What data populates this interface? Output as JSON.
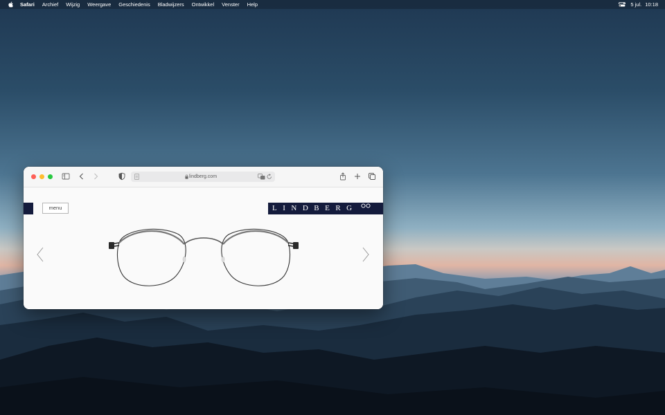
{
  "menubar": {
    "app_name": "Safari",
    "items": [
      "Archief",
      "Wijzig",
      "Weergave",
      "Geschiedenis",
      "Bladwijzers",
      "Ontwikkel",
      "Venster",
      "Help"
    ],
    "date": "5 jul.",
    "time": "10:18"
  },
  "browser": {
    "url": "lindberg.com",
    "icons": [
      "sidebar-icon",
      "back-icon",
      "forward-icon",
      "privacy-shield-icon",
      "page-icon",
      "lock-icon",
      "translate-icon",
      "reload-icon",
      "share-icon",
      "new-tab-icon",
      "tab-overview-icon"
    ]
  },
  "page": {
    "menu_label": "menu",
    "logo_text": "LINDBERG",
    "brand_color": "#141b3c"
  }
}
